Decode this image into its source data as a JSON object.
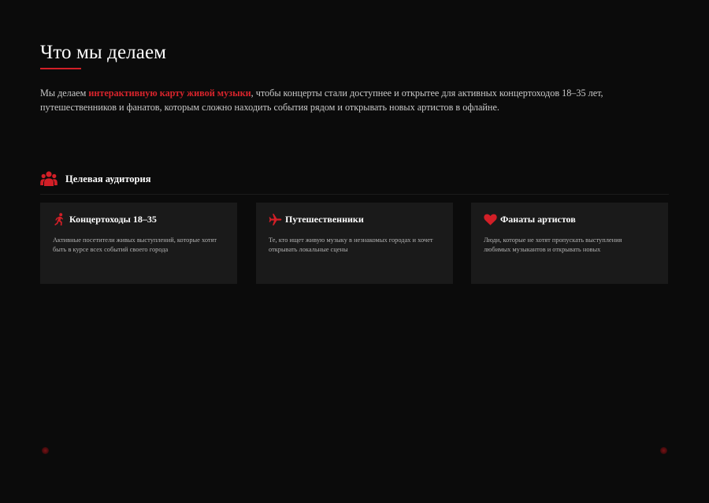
{
  "section": {
    "title": "Что мы делаем",
    "intro": {
      "before": "Мы делаем ",
      "highlight": "интерактивную карту живой музыки",
      "after": ", чтобы концерты стали доступнее и открытее для активных концертоходов 18–35 лет, путешественников и фанатов, которым сложно находить события рядом и открывать новых артистов в офлайне."
    }
  },
  "audience": {
    "icon": "users-icon",
    "heading": "Целевая аудитория",
    "cards": [
      {
        "icon": "running-person-icon",
        "title": "Концертоходы 18–35",
        "text": "Активные посетители живых выступлений, которые хотят быть в курсе всех событий своего города"
      },
      {
        "icon": "airplane-icon",
        "title": "Путешественники",
        "text": "Те, кто ищет живую музыку в незнакомых городах и хочет открывать локальные сцены"
      },
      {
        "icon": "heart-icon",
        "title": "Фанаты артистов",
        "text": "Люди, которые не хотят пропускать выступления любимых музыкантов и открывать новых"
      }
    ]
  },
  "colors": {
    "background": "#0b0b0b",
    "card": "#1a1a1a",
    "accent": "#d21f27",
    "text": "#c9c9c9"
  }
}
